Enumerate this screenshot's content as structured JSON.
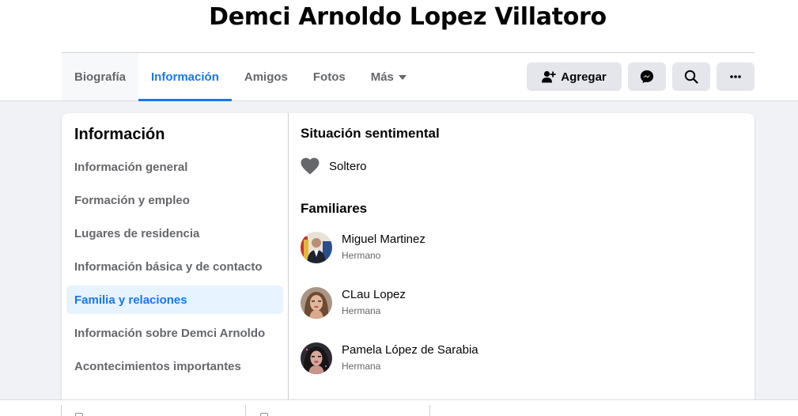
{
  "profile": {
    "name": "Demci Arnoldo Lopez Villatoro"
  },
  "tabs": [
    {
      "label": "Biografía"
    },
    {
      "label": "Información"
    },
    {
      "label": "Amigos"
    },
    {
      "label": "Fotos"
    },
    {
      "label": "Más"
    }
  ],
  "actions": {
    "add_label": "Agregar",
    "icons": [
      "add-friend-icon",
      "messenger-icon",
      "search-icon",
      "more-icon"
    ]
  },
  "sidebar": {
    "title": "Información",
    "items": [
      {
        "label": "Información general"
      },
      {
        "label": "Formación y empleo"
      },
      {
        "label": "Lugares de residencia"
      },
      {
        "label": "Información básica y de contacto"
      },
      {
        "label": "Familia y relaciones"
      },
      {
        "label": "Información sobre Demci Arnoldo"
      },
      {
        "label": "Acontecimientos importantes"
      }
    ],
    "active_index": 4
  },
  "relationship": {
    "title": "Situación sentimental",
    "status": "Soltero",
    "icon": "heart-icon"
  },
  "family": {
    "title": "Familiares",
    "members": [
      {
        "name": "Miguel Martinez",
        "relation": "Hermano"
      },
      {
        "name": "CLau Lopez",
        "relation": "Hermana"
      },
      {
        "name": "Pamela López de Sarabia",
        "relation": "Hermana"
      }
    ]
  },
  "colors": {
    "accent": "#1877f2",
    "secondary_text": "#65676b",
    "button_bg": "#e4e6eb",
    "page_bg": "#f0f2f5",
    "active_item_bg": "#e7f3ff"
  }
}
